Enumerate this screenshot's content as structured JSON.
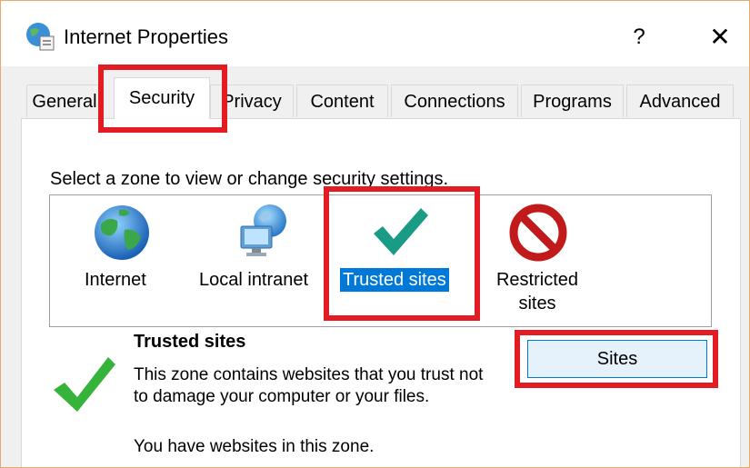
{
  "window": {
    "title": "Internet Properties",
    "help_label": "?",
    "close_label": "✕"
  },
  "tabs": [
    {
      "label": "General",
      "active": false
    },
    {
      "label": "Security",
      "active": true
    },
    {
      "label": "Privacy",
      "active": false
    },
    {
      "label": "Content",
      "active": false
    },
    {
      "label": "Connections",
      "active": false
    },
    {
      "label": "Programs",
      "active": false
    },
    {
      "label": "Advanced",
      "active": false
    }
  ],
  "security": {
    "zone_prompt": "Select a zone to view or change security settings.",
    "zones": [
      {
        "name": "Internet",
        "icon": "globe-icon"
      },
      {
        "name": "Local intranet",
        "icon": "intranet-icon"
      },
      {
        "name": "Trusted sites",
        "icon": "checkmark-icon",
        "selected": true
      },
      {
        "name_line1": "Restricted",
        "name_line2": "sites",
        "icon": "prohibited-icon"
      }
    ],
    "selected_zone": {
      "title": "Trusted sites",
      "description": "This zone contains websites that you trust not to damage your computer or your files.",
      "status": "You have websites in this zone.",
      "sites_button": "Sites"
    }
  },
  "colors": {
    "highlight": "#e31b23",
    "selection": "#0078d7",
    "button_bg": "#e5f1fb"
  }
}
